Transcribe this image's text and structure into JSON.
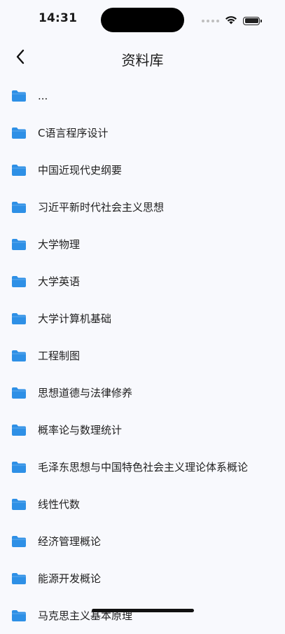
{
  "status_bar": {
    "time": "14:31"
  },
  "nav": {
    "title": "资料库",
    "back_icon": "chevron-left-icon"
  },
  "colors": {
    "folder": "#2e90e6",
    "background": "#f8f9fd"
  },
  "folders": [
    {
      "label": "..."
    },
    {
      "label": "C语言程序设计"
    },
    {
      "label": "中国近现代史纲要"
    },
    {
      "label": "习近平新时代社会主义思想"
    },
    {
      "label": "大学物理"
    },
    {
      "label": "大学英语"
    },
    {
      "label": "大学计算机基础"
    },
    {
      "label": "工程制图"
    },
    {
      "label": "思想道德与法律修养"
    },
    {
      "label": "概率论与数理统计"
    },
    {
      "label": "毛泽东思想与中国特色社会主义理论体系概论"
    },
    {
      "label": "线性代数"
    },
    {
      "label": "经济管理概论"
    },
    {
      "label": "能源开发概论"
    },
    {
      "label": "马克思主义基本原理"
    }
  ]
}
